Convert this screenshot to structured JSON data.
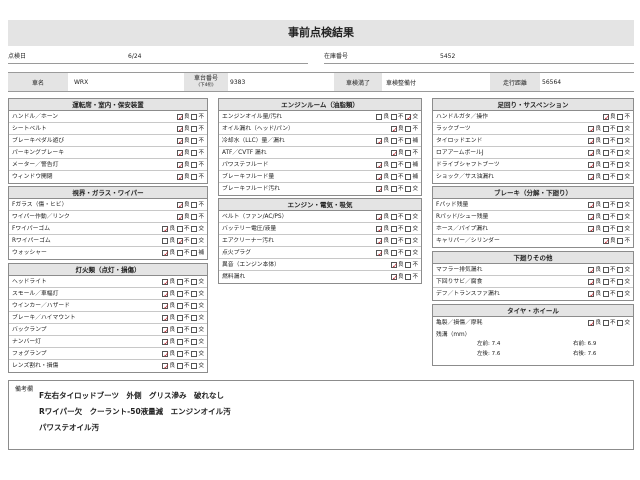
{
  "title": "事前点検結果",
  "info": {
    "inspection_date_label": "点検日",
    "inspection_date_value": "6/24",
    "stock_no_label": "在庫番号",
    "stock_no_value": "5452"
  },
  "vehicle": {
    "name_label": "車名",
    "name_value": "WRX",
    "chassis_label": "車台番号",
    "chassis_sub": "(下4桁)",
    "chassis_value": "9383",
    "inspection_label": "車検満了",
    "inspection_value": "車検整備付",
    "mileage_label": "走行距離",
    "mileage_value": "56564"
  },
  "options": {
    "good": "良",
    "no": "不",
    "exchange": "交",
    "add": "補",
    "clean": "清"
  },
  "sections": {
    "driving": {
      "title": "運転席・室内・保安装置",
      "rows": [
        {
          "label": "ハンドル／ホーン",
          "opts": [
            [
              "good",
              true
            ],
            [
              "no",
              false
            ]
          ]
        },
        {
          "label": "シートベルト",
          "opts": [
            [
              "good",
              true
            ],
            [
              "no",
              false
            ]
          ]
        },
        {
          "label": "ブレーキペダル遊び",
          "opts": [
            [
              "good",
              true
            ],
            [
              "no",
              false
            ]
          ]
        },
        {
          "label": "パーキングブレーキ",
          "opts": [
            [
              "good",
              true
            ],
            [
              "no",
              false
            ]
          ]
        },
        {
          "label": "メーター／警告灯",
          "opts": [
            [
              "good",
              true
            ],
            [
              "no",
              false
            ]
          ]
        },
        {
          "label": "ウィンドウ開閉",
          "opts": [
            [
              "good",
              true
            ],
            [
              "no",
              false
            ]
          ]
        }
      ]
    },
    "visibility": {
      "title": "視界・ガラス・ワイパー",
      "rows": [
        {
          "label": "Fガラス（傷・ヒビ）",
          "opts": [
            [
              "good",
              true
            ],
            [
              "no",
              false
            ]
          ]
        },
        {
          "label": "ワイパー作動／リンク",
          "opts": [
            [
              "good",
              true
            ],
            [
              "no",
              false
            ]
          ]
        },
        {
          "label": "Fワイパーゴム",
          "opts": [
            [
              "good",
              true
            ],
            [
              "no",
              false
            ],
            [
              "exchange",
              false
            ]
          ]
        },
        {
          "label": "Rワイパーゴム",
          "opts": [
            [
              "good",
              false
            ],
            [
              "no",
              true
            ],
            [
              "exchange",
              false
            ]
          ]
        },
        {
          "label": "ウォッシャー",
          "opts": [
            [
              "good",
              true
            ],
            [
              "no",
              false
            ],
            [
              "add",
              false
            ]
          ]
        }
      ]
    },
    "lights": {
      "title": "灯火類（点灯・損傷）",
      "rows": [
        {
          "label": "ヘッドライト",
          "opts": [
            [
              "good",
              true
            ],
            [
              "no",
              false
            ],
            [
              "exchange",
              false
            ]
          ]
        },
        {
          "label": "スモール／車幅灯",
          "opts": [
            [
              "good",
              true
            ],
            [
              "no",
              false
            ],
            [
              "exchange",
              false
            ]
          ]
        },
        {
          "label": "ウインカー／ハザード",
          "opts": [
            [
              "good",
              true
            ],
            [
              "no",
              false
            ],
            [
              "exchange",
              false
            ]
          ]
        },
        {
          "label": "ブレーキ／ハイマウント",
          "opts": [
            [
              "good",
              true
            ],
            [
              "no",
              false
            ],
            [
              "exchange",
              false
            ]
          ]
        },
        {
          "label": "バックランプ",
          "opts": [
            [
              "good",
              true
            ],
            [
              "no",
              false
            ],
            [
              "exchange",
              false
            ]
          ]
        },
        {
          "label": "ナンバー灯",
          "opts": [
            [
              "good",
              true
            ],
            [
              "no",
              false
            ],
            [
              "exchange",
              false
            ]
          ]
        },
        {
          "label": "フォグランプ",
          "opts": [
            [
              "good",
              true
            ],
            [
              "no",
              false
            ],
            [
              "exchange",
              false
            ]
          ]
        },
        {
          "label": "レンズ割れ・損傷",
          "opts": [
            [
              "good",
              true
            ],
            [
              "no",
              false
            ],
            [
              "exchange",
              false
            ]
          ]
        }
      ]
    },
    "engine_room": {
      "title": "エンジンルーム（油脂類）",
      "rows": [
        {
          "label": "エンジンオイル量/汚れ",
          "opts": [
            [
              "good",
              false
            ],
            [
              "no",
              false
            ],
            [
              "exchange",
              true
            ]
          ]
        },
        {
          "label": "オイル漏れ（ヘッド/パン）",
          "opts": [
            [
              "good",
              true
            ],
            [
              "no",
              false
            ]
          ]
        },
        {
          "label": "冷却水（LLC）量／漏れ",
          "opts": [
            [
              "good",
              true
            ],
            [
              "no",
              false
            ],
            [
              "add",
              false
            ]
          ]
        },
        {
          "label": "ATF／CVTF 漏れ",
          "opts": [
            [
              "good",
              true
            ],
            [
              "no",
              false
            ]
          ]
        },
        {
          "label": "パワステフルード",
          "opts": [
            [
              "good",
              true
            ],
            [
              "no",
              false
            ],
            [
              "add",
              false
            ]
          ]
        },
        {
          "label": "ブレーキフルード量",
          "opts": [
            [
              "good",
              true
            ],
            [
              "no",
              false
            ],
            [
              "add",
              false
            ]
          ]
        },
        {
          "label": "ブレーキフルード汚れ",
          "opts": [
            [
              "good",
              true
            ],
            [
              "no",
              false
            ],
            [
              "exchange",
              false
            ]
          ]
        }
      ]
    },
    "engine_elec": {
      "title": "エンジン・電気・吸気",
      "rows": [
        {
          "label": "ベルト（ファン/AC/PS）",
          "opts": [
            [
              "good",
              true
            ],
            [
              "no",
              false
            ],
            [
              "exchange",
              false
            ]
          ]
        },
        {
          "label": "バッテリー電圧/液量",
          "opts": [
            [
              "good",
              true
            ],
            [
              "no",
              false
            ],
            [
              "exchange",
              false
            ]
          ]
        },
        {
          "label": "エアクリーナー汚れ",
          "opts": [
            [
              "good",
              true
            ],
            [
              "no",
              false
            ],
            [
              "exchange",
              false
            ]
          ]
        },
        {
          "label": "点火プラグ",
          "opts": [
            [
              "good",
              true
            ],
            [
              "no",
              false
            ],
            [
              "exchange",
              false
            ]
          ]
        },
        {
          "label": "異音（エンジン本体）",
          "opts": [
            [
              "good",
              true
            ],
            [
              "no",
              false
            ]
          ]
        },
        {
          "label": "燃料漏れ",
          "opts": [
            [
              "good",
              true
            ],
            [
              "no",
              false
            ]
          ]
        }
      ]
    },
    "suspension": {
      "title": "足回り・サスペンション",
      "rows": [
        {
          "label": "ハンドルガタ／操作",
          "opts": [
            [
              "good",
              true
            ],
            [
              "no",
              false
            ]
          ]
        },
        {
          "label": "ラックブーツ",
          "opts": [
            [
              "good",
              true
            ],
            [
              "no",
              false
            ],
            [
              "exchange",
              false
            ]
          ]
        },
        {
          "label": "タイロッドエンド",
          "opts": [
            [
              "good",
              true
            ],
            [
              "no",
              false
            ],
            [
              "exchange",
              false
            ]
          ]
        },
        {
          "label": "ロアアームボールJ",
          "opts": [
            [
              "good",
              true
            ],
            [
              "no",
              false
            ],
            [
              "exchange",
              false
            ]
          ]
        },
        {
          "label": "ドライブシャフトブーツ",
          "opts": [
            [
              "good",
              true
            ],
            [
              "no",
              false
            ],
            [
              "exchange",
              false
            ]
          ]
        },
        {
          "label": "ショック／サス油漏れ",
          "opts": [
            [
              "good",
              true
            ],
            [
              "no",
              false
            ],
            [
              "exchange",
              false
            ]
          ]
        }
      ]
    },
    "brakes": {
      "title": "ブレーキ（分解・下廻り）",
      "rows": [
        {
          "label": "Fパッド残量",
          "opts": [
            [
              "good",
              true
            ],
            [
              "no",
              false
            ],
            [
              "exchange",
              false
            ]
          ]
        },
        {
          "label": "Rパッド/シュー残量",
          "opts": [
            [
              "good",
              true
            ],
            [
              "no",
              false
            ],
            [
              "exchange",
              false
            ]
          ]
        },
        {
          "label": "ホース／パイプ漏れ",
          "opts": [
            [
              "good",
              true
            ],
            [
              "no",
              false
            ],
            [
              "exchange",
              false
            ]
          ]
        },
        {
          "label": "キャリパー／シリンダー",
          "opts": [
            [
              "good",
              true
            ],
            [
              "no",
              false
            ]
          ]
        }
      ]
    },
    "underbody": {
      "title": "下廻りその他",
      "rows": [
        {
          "label": "マフラー排気漏れ",
          "opts": [
            [
              "good",
              true
            ],
            [
              "no",
              false
            ],
            [
              "exchange",
              false
            ]
          ]
        },
        {
          "label": "下回りサビ／腐食",
          "opts": [
            [
              "good",
              true
            ],
            [
              "no",
              false
            ],
            [
              "exchange",
              false
            ]
          ]
        },
        {
          "label": "デフ／トランスファ漏れ",
          "opts": [
            [
              "good",
              true
            ],
            [
              "no",
              false
            ],
            [
              "exchange",
              false
            ]
          ]
        }
      ]
    },
    "tires": {
      "title": "タイヤ・ホイール",
      "rows": [
        {
          "label": "亀裂／損傷／摩耗",
          "opts": [
            [
              "good",
              true
            ],
            [
              "no",
              false
            ],
            [
              "exchange",
              false
            ]
          ]
        }
      ],
      "tread_label": "残溝（mm）",
      "front_left": "左前: 7.4",
      "front_right": "右前: 6.9",
      "rear_left": "左後: 7.6",
      "rear_right": "右後: 7.6"
    }
  },
  "remarks": {
    "label": "備考欄",
    "lines": [
      "F左右タイロッドブーツ　外側　グリス滲み　破れなし",
      "Rワイパー欠　クーラント-50液量減　エンジンオイル汚",
      "パワステオイル汚"
    ]
  }
}
